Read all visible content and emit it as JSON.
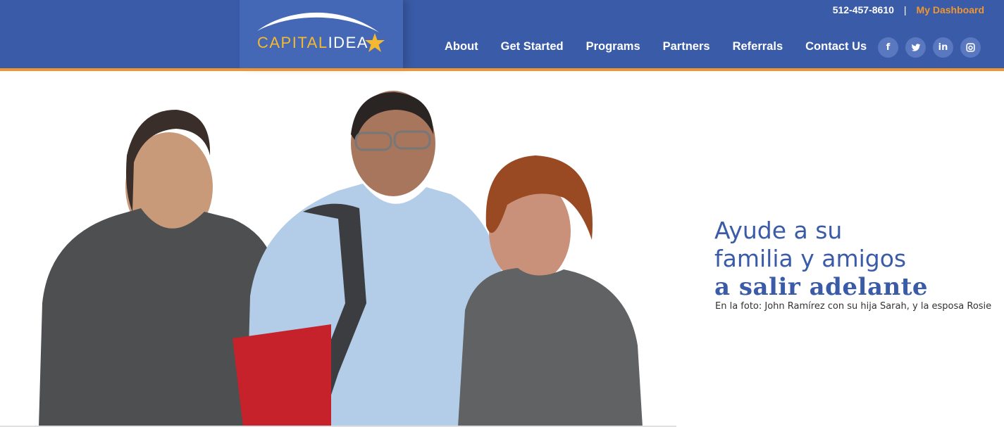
{
  "logo": {
    "part1": "CAPITAL",
    "part2": "IDEA"
  },
  "topbar": {
    "phone": "512-457-8610",
    "separator": "|",
    "dashboard": "My Dashboard"
  },
  "nav": [
    {
      "label": "About"
    },
    {
      "label": "Get Started"
    },
    {
      "label": "Programs"
    },
    {
      "label": "Partners"
    },
    {
      "label": "Referrals"
    },
    {
      "label": "Contact Us"
    }
  ],
  "social": [
    {
      "icon": "facebook-icon",
      "glyph": "f"
    },
    {
      "icon": "twitter-icon",
      "glyph": "t"
    },
    {
      "icon": "linkedin-icon",
      "glyph": "in"
    },
    {
      "icon": "instagram-icon",
      "glyph": "◘"
    }
  ],
  "hero": {
    "line1": "Ayude a su",
    "line2": "familia y amigos",
    "line3": "a salir adelante",
    "caption": "En la foto: John Ramírez con su hija Sarah, y la esposa Rosie"
  },
  "colors": {
    "header": "#3a5ba8",
    "accent": "#f0962e",
    "logo_gold": "#f5b82e"
  }
}
